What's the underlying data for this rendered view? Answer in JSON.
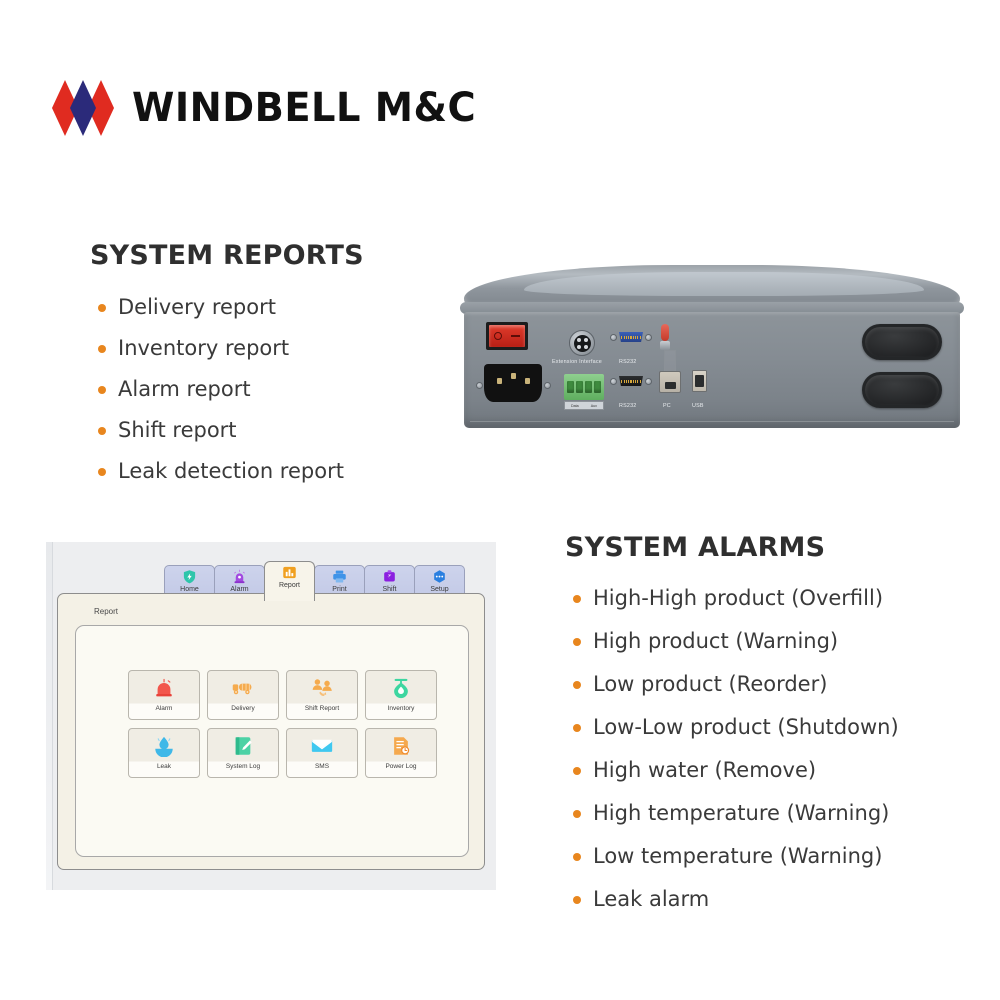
{
  "brand": {
    "name": "WINDBELL M&C",
    "logo_icon": "windbell-diamonds-logo",
    "colors": {
      "red": "#E02B20",
      "blue": "#2B2A7A"
    }
  },
  "reports_section": {
    "title": "SYSTEM REPORTS",
    "bullet_color": "#E8861E",
    "items": [
      "Delivery report",
      "Inventory report",
      " Alarm report",
      "Shift report",
      "Leak detection report"
    ]
  },
  "alarms_section": {
    "title": "SYSTEM ALARMS",
    "bullet_color": "#E8861E",
    "items": [
      "High-High product (Overfill)",
      "High product (Warning)",
      " Low product (Reorder)",
      "Low-Low product (Shutdown)",
      "High water (Remove)",
      "High temperature (Warning)",
      "Low temperature (Warning)",
      "Leak alarm"
    ]
  },
  "device": {
    "name": "console-rear-panel-photo",
    "body_color": "#858C93",
    "port_labels": {
      "extension": "Extension Interface",
      "rs232_top": "RS232",
      "rs232_bottom": "RS232",
      "pc": "PC",
      "usb": "USB"
    },
    "terminal_block_labels": {
      "left": "Data",
      "right": "Aux"
    },
    "power_switch": {
      "off_mark": "O",
      "on_mark": "—",
      "color": "#C62A1C"
    }
  },
  "hmi": {
    "breadcrumb": "Report",
    "tabs": [
      {
        "label": "Home",
        "icon": "shield-bolt-icon",
        "color": "#2ec5ab",
        "active": false
      },
      {
        "label": "Alarm",
        "icon": "siren-icon",
        "color": "#a24ae0",
        "active": false
      },
      {
        "label": "Report",
        "icon": "bar-chart-icon",
        "color": "#f0a020",
        "active": true
      },
      {
        "label": "Print",
        "icon": "printer-icon",
        "color": "#3f93e8",
        "active": false
      },
      {
        "label": "Shift",
        "icon": "shift-badge-icon",
        "color": "#8b1fe0",
        "active": false
      },
      {
        "label": "Setup",
        "icon": "settings-dots-icon",
        "color": "#2a7fe0",
        "active": false
      }
    ],
    "buttons": [
      {
        "label": "Alarm",
        "icon": "alarm-siren-icon",
        "color": "#f2564c"
      },
      {
        "label": "Delivery",
        "icon": "tanker-truck-icon",
        "color": "#f5ab4e"
      },
      {
        "label": "Shift Report",
        "icon": "people-shift-icon",
        "color": "#f5ab4e"
      },
      {
        "label": "Inventory",
        "icon": "tank-gauge-icon",
        "color": "#3dd6a0"
      },
      {
        "label": "Leak",
        "icon": "leak-drop-icon",
        "color": "#3fb8e8"
      },
      {
        "label": "System Log",
        "icon": "notebook-pen-icon",
        "color": "#4cd2a5"
      },
      {
        "label": "SMS",
        "icon": "envelope-icon",
        "color": "#3fc8f0"
      },
      {
        "label": "Power Log",
        "icon": "document-clock-icon",
        "color": "#f5a94e"
      }
    ]
  }
}
